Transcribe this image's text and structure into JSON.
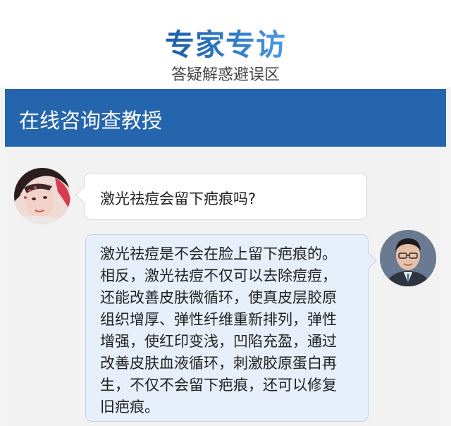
{
  "header": {
    "title": "专家专访",
    "subtitle": "答疑解惑避误区"
  },
  "card": {
    "title": "在线咨询查教授"
  },
  "chat": {
    "question": "激光祛痘会留下疤痕吗?",
    "answer_lines": [
      "激光祛痘是不会在脸上留下疤痕的。",
      "相反，激光祛痘不仅可以去除痘痘，",
      "还能改善皮肤微循环，使真皮层胶原",
      "组织增厚、弹性纤维重新排列，弹性",
      "增强，使红印变浅，凹陷充盈，通过",
      "改善皮肤血液循环，刺激胶原蛋白再",
      "生，不仅不会留下疤痕，还可以修复",
      "旧疤痕。"
    ]
  },
  "colors": {
    "header_blue": "#2565ae",
    "answer_bubble": "#e6effa"
  }
}
